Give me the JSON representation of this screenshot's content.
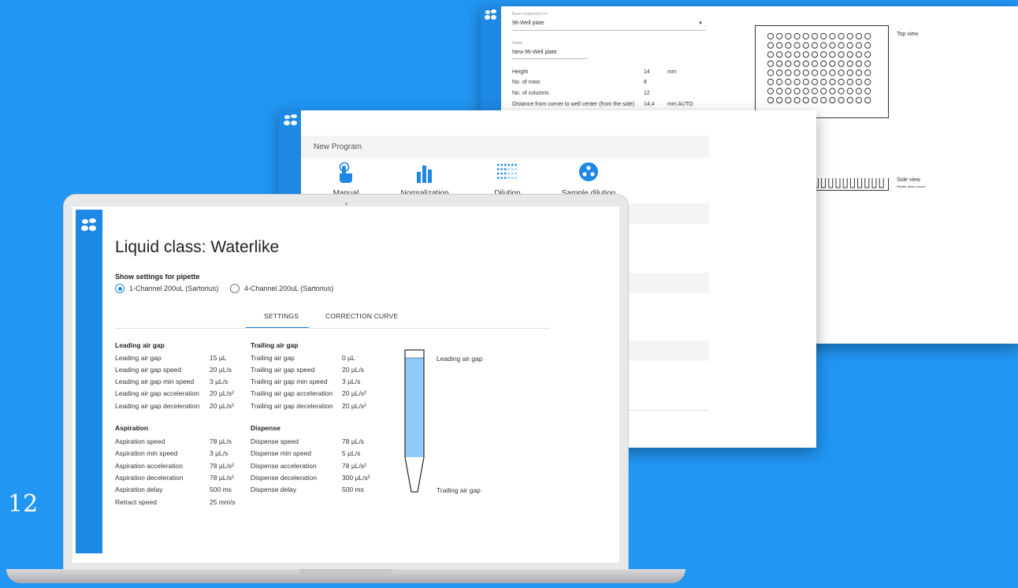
{
  "page_number": "12",
  "plate_window": {
    "base_label": "Base component on",
    "base_value": "96-Well plate",
    "name_label": "Name",
    "name_value": "New 96-Well plate",
    "props": [
      {
        "key": "Height",
        "value": "14",
        "unit": "mm"
      },
      {
        "key": "No. of rows",
        "value": "8",
        "unit": ""
      },
      {
        "key": "No. of columns",
        "value": "12",
        "unit": ""
      },
      {
        "key": "Distance from corner to well center (from the side)",
        "value": "14,4",
        "unit": "mm  AUTO"
      }
    ],
    "top_view_label": "Top view",
    "side_view_label": "Side view",
    "side_view_sub": "Pipette dead volume"
  },
  "program_window": {
    "title": "New Program",
    "items": [
      {
        "label": "Manual",
        "icon": "touch-icon"
      },
      {
        "label": "Normalization",
        "icon": "bar-chart-icon"
      },
      {
        "label": "Dilution",
        "icon": "dot-grid-icon"
      },
      {
        "label": "Sample dilution",
        "icon": "circle-dots-icon"
      }
    ]
  },
  "liquid_class": {
    "title": "Liquid class: Waterlike",
    "pipette_label": "Show settings for pipette",
    "pipettes": [
      {
        "label": "1-Channel 200uL (Sartorius)",
        "selected": true
      },
      {
        "label": "4-Channel 200uL (Sartorius)",
        "selected": false
      }
    ],
    "tabs": [
      "SETTINGS",
      "CORRECTION CURVE"
    ],
    "active_tab": "SETTINGS",
    "sections": {
      "leading": {
        "title": "Leading air gap",
        "rows": [
          {
            "k": "Leading air gap",
            "v": "15 µL"
          },
          {
            "k": "Leading air gap speed",
            "v": "20 µL/s"
          },
          {
            "k": "Leading air gap min speed",
            "v": "3 µL/s"
          },
          {
            "k": "Leading air gap acceleration",
            "v": "20 µL/s²"
          },
          {
            "k": "Leading air gap deceleration",
            "v": "20 µL/s²"
          }
        ]
      },
      "trailing": {
        "title": "Trailing air gap",
        "rows": [
          {
            "k": "Trailing air gap",
            "v": "0 µL"
          },
          {
            "k": "Trailing air gap speed",
            "v": "20 µL/s"
          },
          {
            "k": "Trailing air gap min speed",
            "v": "3 µL/s"
          },
          {
            "k": "Trailing air gap acceleration",
            "v": "20 µL/s²"
          },
          {
            "k": "Trailing air gap deceleration",
            "v": "20 µL/s²"
          }
        ]
      },
      "aspiration": {
        "title": "Aspiration",
        "rows": [
          {
            "k": "Aspiration speed",
            "v": "78 µL/s"
          },
          {
            "k": "Aspiration min speed",
            "v": "3 µL/s"
          },
          {
            "k": "Aspiration acceleration",
            "v": "78 µL/s²"
          },
          {
            "k": "Aspiration deceleration",
            "v": "78 µL/s²"
          },
          {
            "k": "Aspiration delay",
            "v": "500 ms"
          },
          {
            "k": "Retract speed",
            "v": "25 mm/s"
          }
        ]
      },
      "dispense": {
        "title": "Dispense",
        "rows": [
          {
            "k": "Dispense speed",
            "v": "78 µL/s"
          },
          {
            "k": "Dispense min speed",
            "v": "5 µL/s"
          },
          {
            "k": "Dispense acceleration",
            "v": "78 µL/s²"
          },
          {
            "k": "Dispense deceleration",
            "v": "300 µL/s²"
          },
          {
            "k": "Dispense delay",
            "v": "500 ms"
          }
        ]
      }
    },
    "tube_labels": {
      "top": "Leading air gap",
      "bottom": "Trailing air gap"
    }
  },
  "colors": {
    "accent": "#1e88e5",
    "background": "#2196f3",
    "liquid": "#90caf9"
  }
}
